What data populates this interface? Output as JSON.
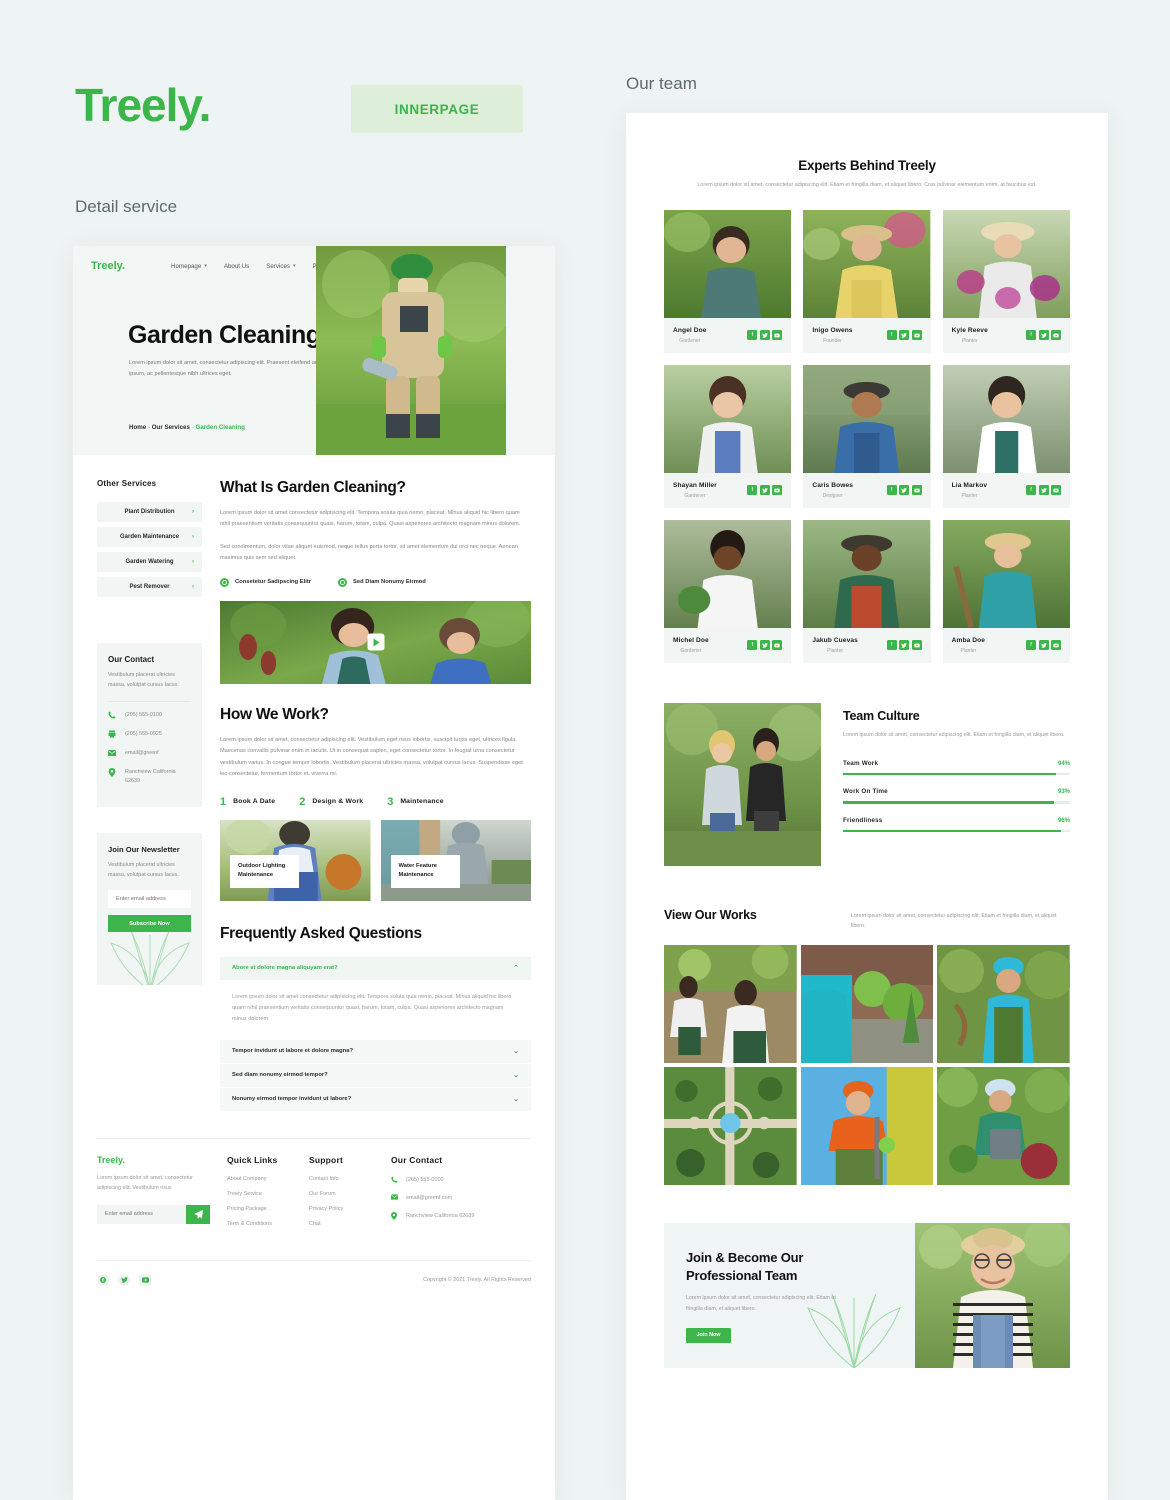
{
  "brand": {
    "name": "Treely",
    "dot": "."
  },
  "badge": {
    "label": "INNERPAGE"
  },
  "captions": {
    "left": "Detail service",
    "right": "Our team"
  },
  "left_page": {
    "nav": {
      "logo": "Treely.",
      "links": [
        {
          "label": "Homepage",
          "caret": "▾"
        },
        {
          "label": "About Us",
          "caret": ""
        },
        {
          "label": "Services",
          "caret": "▾"
        },
        {
          "label": "Pages",
          "caret": "▾"
        }
      ]
    },
    "hero": {
      "title": "Garden Cleaning",
      "subtitle": "Lorem ipsum dolor sit amet, consectetur adipiscing elit. Praesent eleifend arcu ipsum, ac pellentesque nibh ultrices eget.",
      "breadcrumb": {
        "home": "Home",
        "sep": "-",
        "parent": "Our Services",
        "current": "Garden Cleaning"
      }
    },
    "sidebar": {
      "services_title": "Other Services",
      "services": [
        {
          "label": "Plant Distribution",
          "chevron": "›"
        },
        {
          "label": "Garden Maintenance",
          "chevron": "›"
        },
        {
          "label": "Garden Watering",
          "chevron": "›"
        },
        {
          "label": "Pest Remover",
          "chevron": "›"
        }
      ],
      "contact": {
        "title": "Our Contact",
        "desc": "Vestibulum placerat ultricies massa, volutpat cursus lacus.",
        "rows": [
          {
            "icon": "phone-icon",
            "glyph": "✆",
            "text": "(205) 555-0100"
          },
          {
            "icon": "fax-icon",
            "glyph": "🖷",
            "text": "(205) 555-0925"
          },
          {
            "icon": "mail-icon",
            "glyph": "✉",
            "text": "email@greenf"
          },
          {
            "icon": "location-icon",
            "glyph": "⚲",
            "text": "Ranchview California 62639"
          }
        ]
      },
      "newsletter": {
        "title": "Join Our Newsletter",
        "desc": "Vestibulum placerat ultricies massa, volutpat cursus lacus.",
        "placeholder": "Enter email address",
        "button": "Subscribe Now"
      }
    },
    "what_is": {
      "heading": "What Is Garden Cleaning?",
      "p1": "Lorem ipsum dolor sit amet consectetur adipisicing elit. Tempora soluta quia nemo, placeat. Minus aliquid hic libero quam nihil praesentium veritatis consequuntur quasi, harum, totam, culpa. Quasi asperiores architecto magnam minus dolorem.",
      "p2": "Sed condimentum, dolor vitae aliquet euismod, neque tellus porta tortor, sit amet elementum dui orci nec neque. Aenean maximus quis sem sed aliquet.",
      "checks": [
        "Consetetur Sadipscing Elitr",
        "Sed Diam Nonumy Eirmod"
      ]
    },
    "how_we_work": {
      "heading": "How We Work?",
      "p1": "Lorem ipsum dolor sit amet, consectetur adipiscing elit. Vestibulum eget risus lobortis, suscipit turpis eget, ultrices ligula. Maecenas convallis pulvinar enim in iaculis. Ut in consequat sapien, eget consectetur tortor. In feugiat urna consectetur vestibulum varius. In congue tempor lobortis. Vestibulum placerat ultricies massa, volutpat cursus lacus. Suspendisse eget leo consectetur, fermentum tortor et, viverra mi.",
      "steps": [
        {
          "number": "1",
          "title": "Book A Date"
        },
        {
          "number": "2",
          "title": "Design & Work"
        },
        {
          "number": "3",
          "title": "Maintenance"
        }
      ],
      "cards": [
        {
          "caption": "Outdoor Lighting Maintenance"
        },
        {
          "caption": "Water Feature Maintenance"
        }
      ]
    },
    "faq": {
      "heading": "Frequently Asked Questions",
      "items": [
        {
          "q": "Abore et dolore magna aliquyam erat?",
          "open": true,
          "chevron": "⌃",
          "a": "Lorem ipsum dolor sit amet consectetur adipisicing elit. Tempora soluta quia nemo, placeat. Minus aliquid hic libero quam nihil praesentium veritatis consequuntur quasi, harum, totam, culpa. Quasi asperiores architecto magnam minus dolorem."
        },
        {
          "q": "Tempor invidunt ut labore et dolore magna?",
          "open": false,
          "chevron": "⌄",
          "a": ""
        },
        {
          "q": "Sed diam nonumy eirmod tempor?",
          "open": false,
          "chevron": "⌄",
          "a": ""
        },
        {
          "q": "Nonumy eirmod tempor invidunt ut labore?",
          "open": false,
          "chevron": "⌄",
          "a": ""
        }
      ]
    },
    "footer": {
      "logo": "Treely.",
      "desc": "Lorem ipsum dolor sit amet, consectetur adipiscing elit. Vestibulum risus",
      "mail_placeholder": "Enter email address",
      "mail_button_icon": "send-icon",
      "quick_links_title": "Quick Links",
      "quick_links": [
        "About Company",
        "Treely Service",
        "Pricing Package",
        "Term & Conditions"
      ],
      "support_title": "Support",
      "support": [
        "Contact Info",
        "Our Forum",
        "Privacy Policy",
        "Chat"
      ],
      "contact_title": "Our Contact",
      "contact_rows": [
        {
          "icon": "phone-icon",
          "glyph": "✆",
          "text": "(205) 555-0100"
        },
        {
          "icon": "mail-icon",
          "glyph": "✉",
          "text": "email@greenf.com"
        },
        {
          "icon": "location-icon",
          "glyph": "⚲",
          "text": "Ranchview California 62639"
        }
      ],
      "socials": [
        {
          "name": "facebook-icon",
          "glyph": "f"
        },
        {
          "name": "twitter-icon",
          "glyph": "🐦"
        },
        {
          "name": "youtube-icon",
          "glyph": "▶"
        }
      ],
      "copyright": "Copyright © 2021 Treely. All Rights Reserved"
    }
  },
  "right_page": {
    "experts": {
      "heading": "Experts Behind Treely",
      "sub": "Lorem ipsum dolor sit amet, consectetur adipiscing elit. Etiam et fringilla diam, et aliquet libero. Cras pulvinar elementum enim, at faucibus est.",
      "members": [
        {
          "name": "Angel Doe",
          "role": "Gardener"
        },
        {
          "name": "Inigo Owens",
          "role": "Founder"
        },
        {
          "name": "Kyle Reeve",
          "role": "Planter"
        },
        {
          "name": "Shayan Miller",
          "role": "Gardener"
        },
        {
          "name": "Caris Bowes",
          "role": "Designer"
        },
        {
          "name": "Lia Markov",
          "role": "Planter"
        },
        {
          "name": "Michel Doe",
          "role": "Gardener"
        },
        {
          "name": "Jakub Cuevas",
          "role": "Planter"
        },
        {
          "name": "Amba Doe",
          "role": "Planter"
        }
      ],
      "social_glyphs": [
        {
          "name": "facebook-icon",
          "glyph": "f"
        },
        {
          "name": "twitter-icon",
          "glyph": "🐦"
        },
        {
          "name": "youtube-icon",
          "glyph": "▶"
        }
      ]
    },
    "culture": {
      "heading": "Team Culture",
      "desc": "Lorem ipsum dolor sit amet, consectetur adipiscing elit. Etiam et fringilla diam, et aliquet libero.",
      "bars": [
        {
          "label": "Team Work",
          "value": "94%",
          "pct": 94
        },
        {
          "label": "Work On Time",
          "value": "93%",
          "pct": 93
        },
        {
          "label": "Friendliness",
          "value": "96%",
          "pct": 96
        }
      ]
    },
    "works": {
      "heading": "View Our Works",
      "desc": "Lorem ipsum dolor sit amet, consectetur adipiscing elit. Etiam et fringilla diam, et aliquet libero.",
      "count": 6
    },
    "cta": {
      "heading_line1": "Join & Become Our",
      "heading_line2": "Professional Team",
      "desc": "Lorem ipsum dolor sit amet, consectetur adipiscing elit. Etiam et fringilla diam, et aliquet libero.",
      "button": "Join Now"
    }
  },
  "colors": {
    "green": "#3cb54a",
    "page_bg": "#eef4f3",
    "soft_green": "#f1f6f5",
    "badge_bg": "#ddefd9"
  }
}
